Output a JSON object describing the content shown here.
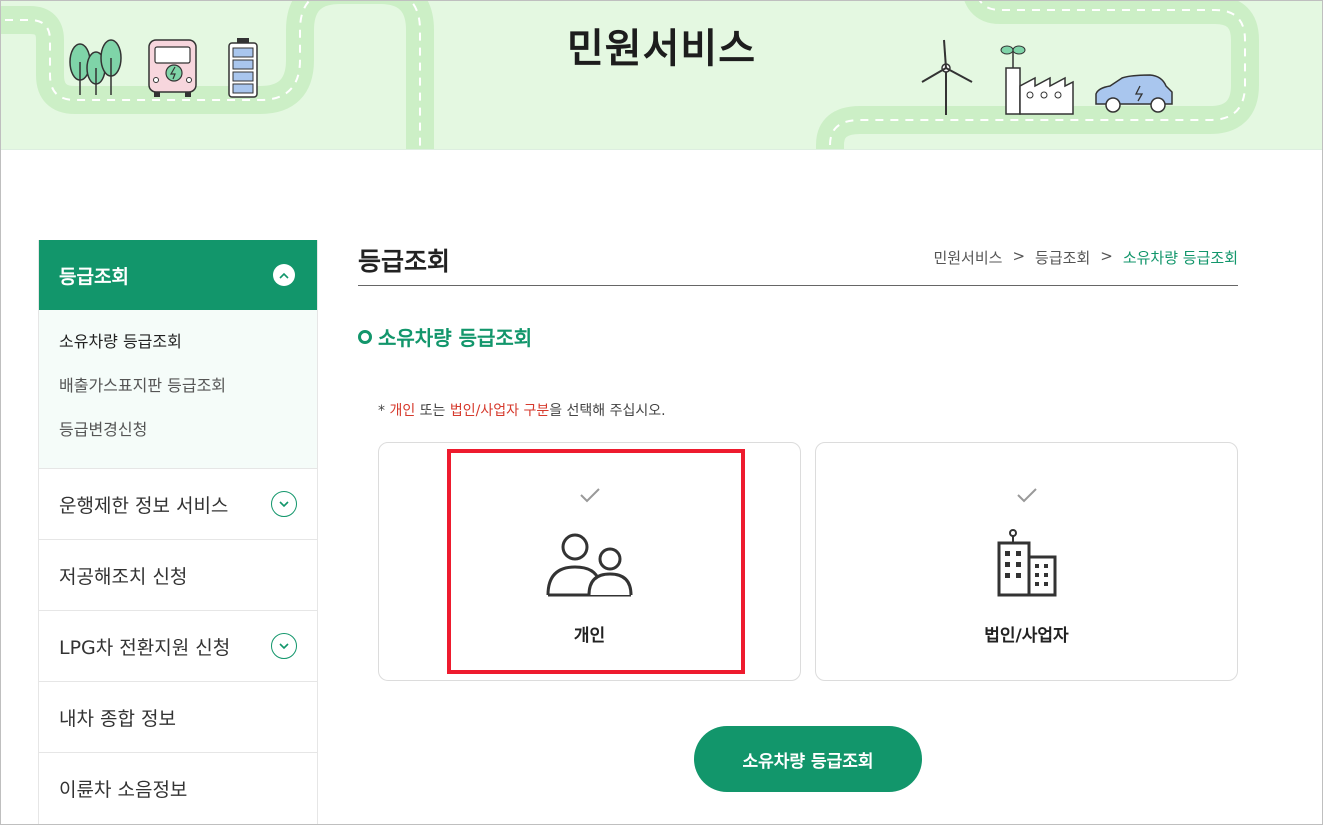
{
  "banner": {
    "title": "민원서비스"
  },
  "sidebar": {
    "active_section": "등급조회",
    "submenu": [
      {
        "label": "소유차량 등급조회"
      },
      {
        "label": "배출가스표지판 등급조회"
      },
      {
        "label": "등급변경신청"
      }
    ],
    "items": [
      {
        "label": "운행제한 정보 서비스"
      },
      {
        "label": "저공해조치 신청"
      },
      {
        "label": "LPG차 전환지원 신청"
      },
      {
        "label": "내차 종합 정보"
      },
      {
        "label": "이륜차 소음정보"
      }
    ]
  },
  "main": {
    "title": "등급조회",
    "breadcrumb": [
      "민원서비스",
      ">",
      "등급조회",
      ">",
      "소유차량 등급조회"
    ],
    "section_title": "소유차량 등급조회",
    "notice": {
      "prefix": "* ",
      "opt1": "개인",
      "mid": " 또는 ",
      "opt2": "법인/사업자 구분",
      "suffix": "을 선택해 주십시오."
    },
    "cards": [
      {
        "label": "개인",
        "icon": "people-icon"
      },
      {
        "label": "법인/사업자",
        "icon": "building-icon"
      }
    ],
    "submit_label": "소유차량 등급조회"
  },
  "colors": {
    "brand_green": "#12966b",
    "banner_bg": "#e4f8e1",
    "highlight_red": "#ee1b2e",
    "notice_red": "#d63a2d"
  }
}
